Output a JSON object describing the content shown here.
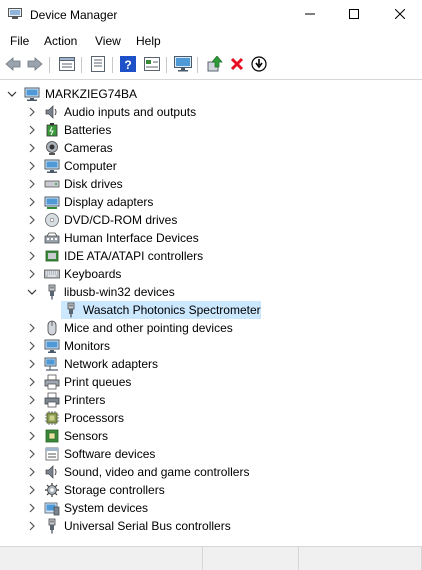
{
  "window": {
    "title": "Device Manager",
    "minimize_icon": "minimize-icon",
    "maximize_icon": "maximize-icon",
    "close_icon": "close-icon"
  },
  "menu": {
    "items": [
      "File",
      "Action",
      "View",
      "Help"
    ]
  },
  "toolbar": {
    "buttons": [
      "back-arrow-icon",
      "forward-arrow-icon",
      "view-tree-icon",
      "properties-icon",
      "help-icon",
      "show-hidden-icon",
      "monitor-icon",
      "update-driver-icon",
      "uninstall-icon",
      "disable-device-icon"
    ]
  },
  "tree": {
    "root": {
      "label": "MARKZIEG74BA",
      "icon": "computer-icon",
      "expanded": true
    },
    "categories": [
      {
        "label": "Audio inputs and outputs",
        "icon": "speaker-icon"
      },
      {
        "label": "Batteries",
        "icon": "battery-icon"
      },
      {
        "label": "Cameras",
        "icon": "camera-icon"
      },
      {
        "label": "Computer",
        "icon": "computer-icon"
      },
      {
        "label": "Disk drives",
        "icon": "disk-drive-icon"
      },
      {
        "label": "Display adapters",
        "icon": "display-adapter-icon"
      },
      {
        "label": "DVD/CD-ROM drives",
        "icon": "dvd-drive-icon"
      },
      {
        "label": "Human Interface Devices",
        "icon": "hid-icon"
      },
      {
        "label": "IDE ATA/ATAPI controllers",
        "icon": "ide-controller-icon"
      },
      {
        "label": "Keyboards",
        "icon": "keyboard-icon"
      },
      {
        "label": "libusb-win32 devices",
        "icon": "usb-plug-icon",
        "expanded": true,
        "children": [
          {
            "label": "Wasatch Photonics Spectrometer",
            "icon": "usb-plug-icon",
            "selected": true
          }
        ]
      },
      {
        "label": "Mice and other pointing devices",
        "icon": "mouse-icon"
      },
      {
        "label": "Monitors",
        "icon": "monitor-icon"
      },
      {
        "label": "Network adapters",
        "icon": "network-adapter-icon"
      },
      {
        "label": "Print queues",
        "icon": "print-queue-icon"
      },
      {
        "label": "Printers",
        "icon": "printer-icon"
      },
      {
        "label": "Processors",
        "icon": "processor-icon"
      },
      {
        "label": "Sensors",
        "icon": "sensor-icon"
      },
      {
        "label": "Software devices",
        "icon": "software-device-icon"
      },
      {
        "label": "Sound, video and game controllers",
        "icon": "speaker-icon"
      },
      {
        "label": "Storage controllers",
        "icon": "storage-controller-icon"
      },
      {
        "label": "System devices",
        "icon": "system-device-icon"
      },
      {
        "label": "Universal Serial Bus controllers",
        "icon": "usb-plug-icon"
      }
    ]
  },
  "colors": {
    "selection": "#cce8ff",
    "uninstall_red": "#e81123",
    "help_blue": "#1e50c8"
  }
}
